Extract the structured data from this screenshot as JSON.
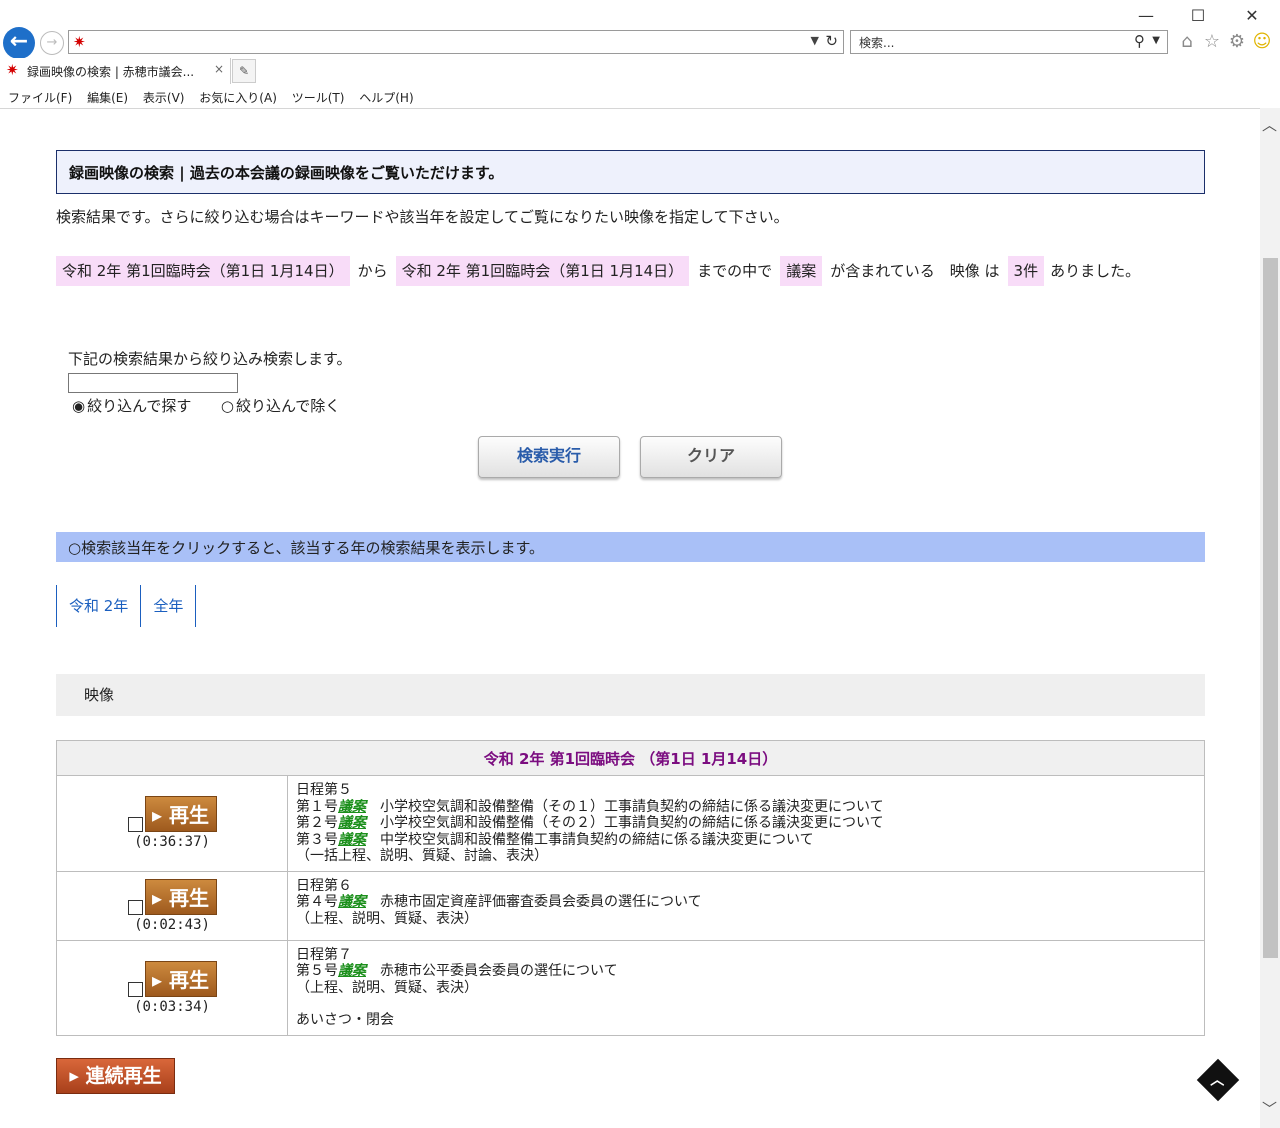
{
  "browser": {
    "window_controls": [
      "—",
      "☐",
      "✕"
    ],
    "search_placeholder": "検索...",
    "tab_title": "録画映像の検索 | 赤穂市議会...",
    "tab_close": "×",
    "menu": [
      "ファイル(F)",
      "編集(E)",
      "表示(V)",
      "お気に入り(A)",
      "ツール(T)",
      "ヘルプ(H)"
    ]
  },
  "page": {
    "title": "録画映像の検索 | 過去の本会議の録画映像をご覧いただけます。",
    "intro": "検索結果です。さらに絞り込む場合はキーワードや該当年を設定してご覧になりたい映像を指定して下さい。",
    "condition": {
      "from": "令和 2年 第1回臨時会（第1日 1月14日）",
      "from_sep": "から",
      "to": "令和 2年 第1回臨時会（第1日 1月14日）",
      "to_sep": "までの中で",
      "keyword": "議案",
      "keyword_sep": "が含まれている　映像 は",
      "count": "3件",
      "tail": "ありました。"
    },
    "narrow": {
      "label": "下記の検索結果から絞り込み検索します。",
      "value": "",
      "radio_include": "絞り込んで探す",
      "radio_exclude": "絞り込んで除く",
      "radio_include_checked": true
    },
    "buttons": {
      "search": "検索実行",
      "clear": "クリア"
    },
    "year_note": "○検索該当年をクリックすると、該当する年の検索結果を表示します。",
    "year_tabs": [
      "令和 2年",
      "全年"
    ],
    "video_heading": "映像",
    "session_title": "令和 2年 第1回臨時会 （第1日 1月14日）",
    "play_label": "再生",
    "rows": [
      {
        "duration": "(0:36:37)",
        "lines": [
          {
            "pre": "日程第５",
            "tag": "",
            "post": ""
          },
          {
            "pre": "第１号",
            "tag": "議案",
            "post": "　小学校空気調和設備整備（その１）工事請負契約の締結に係る議決変更について"
          },
          {
            "pre": "第２号",
            "tag": "議案",
            "post": "　小学校空気調和設備整備（その２）工事請負契約の締結に係る議決変更について"
          },
          {
            "pre": "第３号",
            "tag": "議案",
            "post": "　中学校空気調和設備整備工事請負契約の締結に係る議決変更について"
          },
          {
            "pre": "（一括上程、説明、質疑、討論、表決）",
            "tag": "",
            "post": ""
          }
        ]
      },
      {
        "duration": "(0:02:43)",
        "lines": [
          {
            "pre": "日程第６",
            "tag": "",
            "post": ""
          },
          {
            "pre": "第４号",
            "tag": "議案",
            "post": "　赤穂市固定資産評価審査委員会委員の選任について"
          },
          {
            "pre": "（上程、説明、質疑、表決）",
            "tag": "",
            "post": ""
          }
        ]
      },
      {
        "duration": "(0:03:34)",
        "lines": [
          {
            "pre": "日程第７",
            "tag": "",
            "post": ""
          },
          {
            "pre": "第５号",
            "tag": "議案",
            "post": "　赤穂市公平委員会委員の選任について"
          },
          {
            "pre": "（上程、説明、質疑、表決）",
            "tag": "",
            "post": ""
          },
          {
            "pre": "",
            "tag": "",
            "post": ""
          },
          {
            "pre": "あいさつ・閉会",
            "tag": "",
            "post": ""
          }
        ]
      }
    ],
    "continuous_play": "連続再生"
  }
}
